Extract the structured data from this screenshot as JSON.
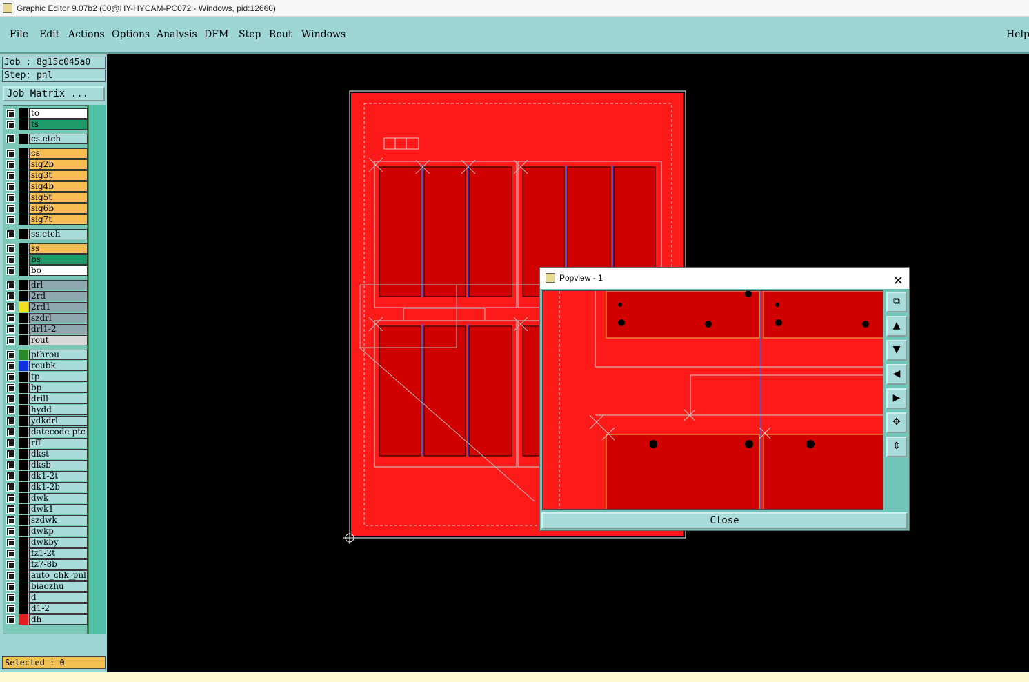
{
  "window": {
    "title": "Graphic Editor 9.07b2 (00@HY-HYCAM-PC072 - Windows, pid:12660)"
  },
  "menubar": {
    "items": [
      "File",
      "Edit",
      "Actions",
      "Options",
      "Analysis",
      "DFM",
      "Step",
      "Rout",
      "Windows"
    ],
    "help": "Help"
  },
  "job": {
    "label": "Job : 8g15c045a0",
    "step": "Step: pnl",
    "matrix_button": "Job Matrix ..."
  },
  "layers": [
    {
      "name": "to",
      "color": "#ffffff"
    },
    {
      "name": "ts",
      "color": "#1f9a6a"
    },
    {
      "name": "cs.etch",
      "color": "#a8dcda"
    },
    {
      "name": "cs",
      "color": "#f5bd52"
    },
    {
      "name": "sig2b",
      "color": "#f5bd52"
    },
    {
      "name": "sig3t",
      "color": "#f5bd52"
    },
    {
      "name": "sig4b",
      "color": "#f5bd52"
    },
    {
      "name": "sig5t",
      "color": "#f5bd52"
    },
    {
      "name": "sig6b",
      "color": "#f5bd52"
    },
    {
      "name": "sig7t",
      "color": "#f5bd52"
    },
    {
      "name": "ss.etch",
      "color": "#a8dcda"
    },
    {
      "name": "ss",
      "color": "#f5bd52"
    },
    {
      "name": "bs",
      "color": "#1f9a6a"
    },
    {
      "name": "bo",
      "color": "#ffffff"
    },
    {
      "name": "drl",
      "color": "#8fa8b0"
    },
    {
      "name": "2rd",
      "color": "#8fa8b0"
    },
    {
      "name": "2rd1",
      "color": "#8fa8b0",
      "swatch": "#f0e020"
    },
    {
      "name": "szdrl",
      "color": "#8fa8b0"
    },
    {
      "name": "drl1-2",
      "color": "#8fa8b0"
    },
    {
      "name": "rout",
      "color": "#d8d8d8"
    },
    {
      "name": "pthrou",
      "color": "#a8dcda",
      "swatch": "#2a8a2a"
    },
    {
      "name": "roubk",
      "color": "#a8dcda",
      "swatch": "#1030e0"
    },
    {
      "name": "tp",
      "color": "#a8dcda"
    },
    {
      "name": "bp",
      "color": "#a8dcda"
    },
    {
      "name": "drill",
      "color": "#a8dcda"
    },
    {
      "name": "hydd",
      "color": "#a8dcda"
    },
    {
      "name": "ydkdrl",
      "color": "#a8dcda"
    },
    {
      "name": "datecode-ptc",
      "color": "#a8dcda"
    },
    {
      "name": "rff",
      "color": "#a8dcda"
    },
    {
      "name": "dkst",
      "color": "#a8dcda"
    },
    {
      "name": "dksb",
      "color": "#a8dcda"
    },
    {
      "name": "dk1-2t",
      "color": "#a8dcda"
    },
    {
      "name": "dk1-2b",
      "color": "#a8dcda"
    },
    {
      "name": "dwk",
      "color": "#a8dcda"
    },
    {
      "name": "dwk1",
      "color": "#a8dcda"
    },
    {
      "name": "szdwk",
      "color": "#a8dcda"
    },
    {
      "name": "dwkp",
      "color": "#a8dcda"
    },
    {
      "name": "dwkby",
      "color": "#a8dcda"
    },
    {
      "name": "fz1-2t",
      "color": "#a8dcda"
    },
    {
      "name": "fz7-8b",
      "color": "#a8dcda"
    },
    {
      "name": "auto_chk_pnl",
      "color": "#a8dcda"
    },
    {
      "name": "biaozhu",
      "color": "#a8dcda"
    },
    {
      "name": "d",
      "color": "#a8dcda"
    },
    {
      "name": "d1-2",
      "color": "#a8dcda"
    },
    {
      "name": "dh",
      "color": "#a8dcda",
      "swatch": "#e02020"
    }
  ],
  "selected": "Selected : 0",
  "popview": {
    "title": "Popview - 1",
    "close_label": "Close"
  },
  "colors": {
    "board": "#ff1a1a",
    "menubar": "#9dd6d4",
    "panel_accent": "#50c0a8"
  }
}
